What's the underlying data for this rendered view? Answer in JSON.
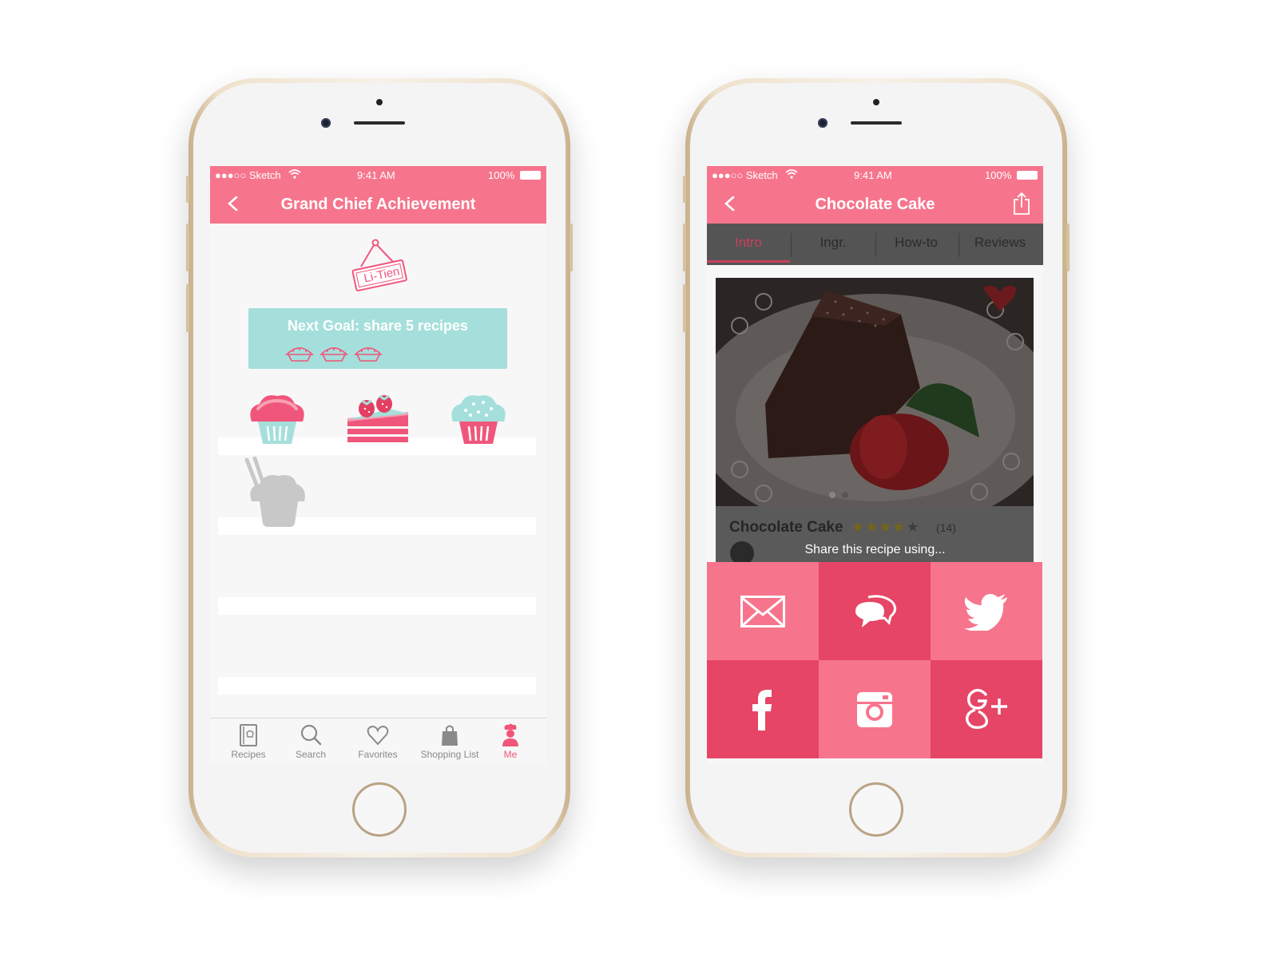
{
  "colors": {
    "brand_pink": "#f6758c",
    "dark_pink": "#e64566",
    "active_pink": "#f0567b",
    "mint": "#a5dfdb"
  },
  "left_phone": {
    "status": {
      "carrier": "●●●○○ Sketch",
      "wifi_icon": "wifi-icon",
      "time": "9:41 AM",
      "battery": "100%"
    },
    "title": "Grand Chief Achievement",
    "badge_sign": "Li-Tien",
    "goal": {
      "text": "Next Goal: share 5 recipes",
      "pie_icons": [
        "pie-icon",
        "pie-icon",
        "pie-icon"
      ]
    },
    "badges": [
      "pink-cupcake-icon",
      "strawberry-cake-icon",
      "mint-cupcake-icon",
      "locked-cupcake-icon"
    ],
    "tabs": [
      {
        "label": "Recipes",
        "icon": "recipe-book-icon",
        "active": false
      },
      {
        "label": "Search",
        "icon": "search-icon",
        "active": false
      },
      {
        "label": "Favorites",
        "icon": "heart-icon",
        "active": false
      },
      {
        "label": "Shopping List",
        "icon": "shopping-bag-icon",
        "active": false
      },
      {
        "label": "Me",
        "icon": "chef-icon",
        "active": true
      }
    ]
  },
  "right_phone": {
    "status": {
      "carrier": "●●●○○ Sketch",
      "wifi_icon": "wifi-icon",
      "time": "9:41 AM",
      "battery": "100%"
    },
    "title": "Chocolate Cake",
    "segments": [
      "Intro",
      "Ingr.",
      "How-to",
      "Reviews"
    ],
    "selected_segment": "Intro",
    "card": {
      "name": "Chocolate Cake",
      "rating": 4,
      "rating_max": 5,
      "review_count": "(14)"
    },
    "share_prompt": "Share this recipe using...",
    "share_options": [
      {
        "icon": "mail-icon"
      },
      {
        "icon": "chat-icon"
      },
      {
        "icon": "twitter-icon"
      },
      {
        "icon": "facebook-icon"
      },
      {
        "icon": "instagram-icon"
      },
      {
        "icon": "google-plus-icon"
      }
    ]
  }
}
